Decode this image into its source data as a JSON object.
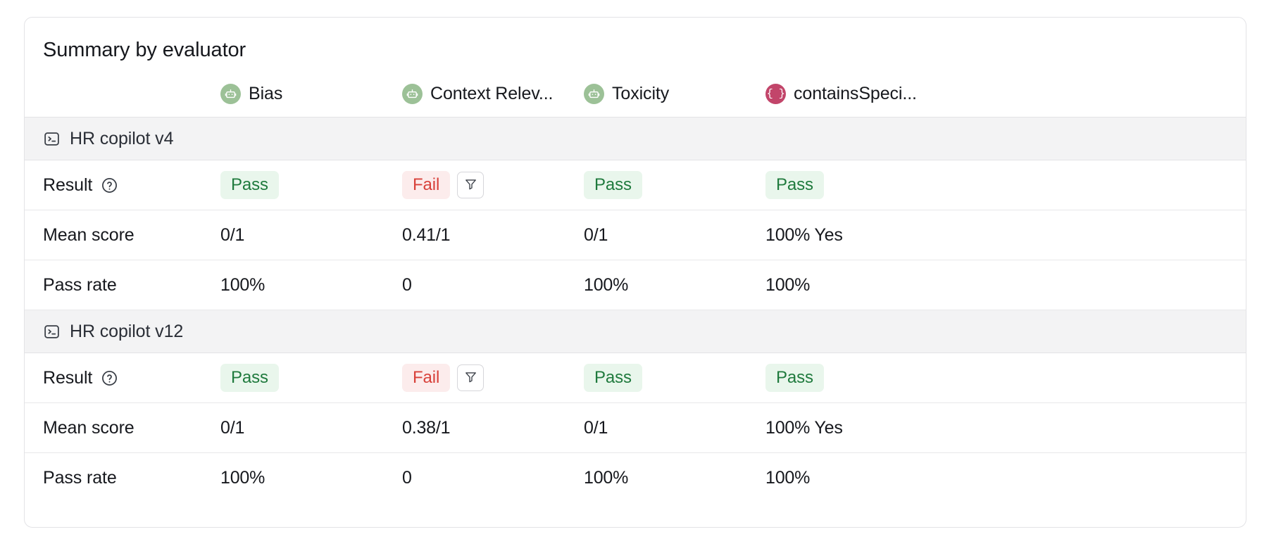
{
  "card": {
    "title": "Summary by evaluator"
  },
  "columns": [
    {
      "label": "Bias",
      "icon": "robot-icon",
      "icon_color": "#9cc197",
      "icon_kind": "robot"
    },
    {
      "label": "Context Relev...",
      "icon": "robot-icon",
      "icon_color": "#9cc197",
      "icon_kind": "robot"
    },
    {
      "label": "Toxicity",
      "icon": "robot-icon",
      "icon_color": "#9cc197",
      "icon_kind": "robot"
    },
    {
      "label": "containsSpeci...",
      "icon": "code-braces-icon",
      "icon_color": "#c2456a",
      "icon_kind": "braces",
      "icon_text": "{ }"
    }
  ],
  "row_labels": {
    "result": "Result",
    "mean_score": "Mean score",
    "pass_rate": "Pass rate"
  },
  "icons": {
    "help": "help-circle-icon",
    "terminal": "terminal-icon",
    "filter": "filter-icon"
  },
  "groups": [
    {
      "name": "HR copilot v4",
      "icon": "terminal-icon",
      "result": [
        {
          "status": "Pass",
          "kind": "pass",
          "has_filter": false
        },
        {
          "status": "Fail",
          "kind": "fail",
          "has_filter": true
        },
        {
          "status": "Pass",
          "kind": "pass",
          "has_filter": false
        },
        {
          "status": "Pass",
          "kind": "pass",
          "has_filter": false
        }
      ],
      "mean_score": [
        "0/1",
        "0.41/1",
        "0/1",
        "100% Yes"
      ],
      "pass_rate": [
        "100%",
        "0",
        "100%",
        "100%"
      ]
    },
    {
      "name": "HR copilot v12",
      "icon": "terminal-icon",
      "result": [
        {
          "status": "Pass",
          "kind": "pass",
          "has_filter": false
        },
        {
          "status": "Fail",
          "kind": "fail",
          "has_filter": true
        },
        {
          "status": "Pass",
          "kind": "pass",
          "has_filter": false
        },
        {
          "status": "Pass",
          "kind": "pass",
          "has_filter": false
        }
      ],
      "mean_score": [
        "0/1",
        "0.38/1",
        "0/1",
        "100% Yes"
      ],
      "pass_rate": [
        "100%",
        "0",
        "100%",
        "100%"
      ]
    }
  ],
  "colors": {
    "pass_bg": "#e9f6ec",
    "pass_text": "#1f7a3d",
    "fail_bg": "#fcecec",
    "fail_text": "#d8413a",
    "group_row_bg": "#f3f3f4",
    "border": "#e3e3e6"
  }
}
